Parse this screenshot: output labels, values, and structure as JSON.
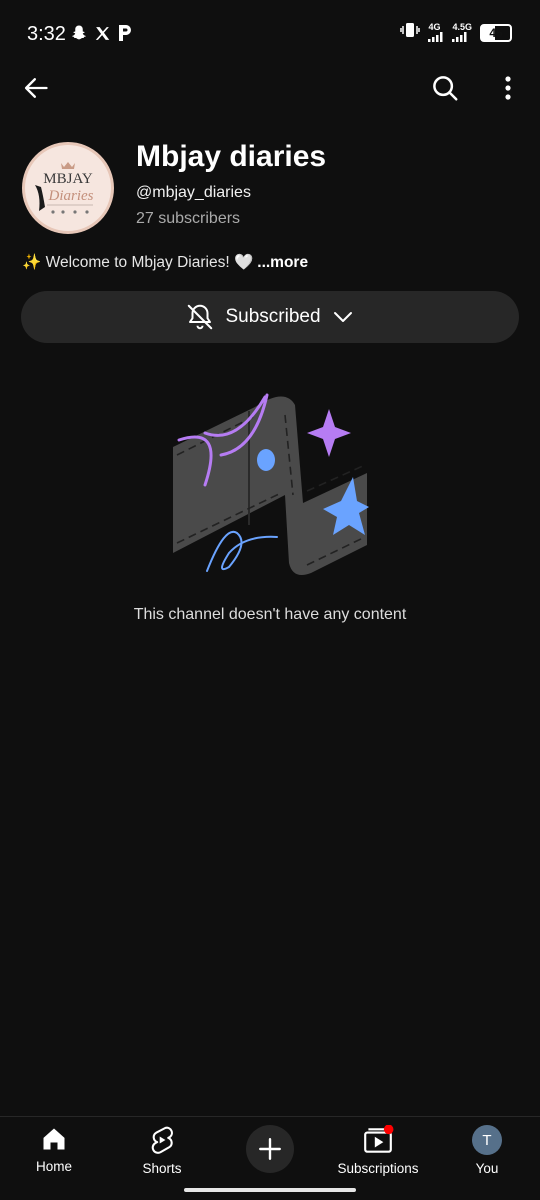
{
  "status_bar": {
    "time": "3:32",
    "network_1": "4G",
    "network_2": "4.5G",
    "battery": "45",
    "battery_level": 0.45
  },
  "top_bar": {
    "icons": [
      "back-arrow-icon",
      "search-icon",
      "more-vert-icon"
    ]
  },
  "channel": {
    "name": "Mbjay diaries",
    "handle": "@mbjay_diaries",
    "subscribers": "27 subscribers",
    "avatar_text_top": "MBJAY",
    "avatar_text_script": "Diaries",
    "description": "✨ Welcome to Mbjay Diaries! 🤍",
    "more_label": "...more"
  },
  "subscribe_button": {
    "label": "Subscribed",
    "icon": "bell-off-icon"
  },
  "empty_state": {
    "message": "This channel doesn't have any content"
  },
  "bottom_nav": {
    "items": [
      {
        "label": "Home",
        "icon": "home-icon"
      },
      {
        "label": "Shorts",
        "icon": "shorts-icon"
      },
      {
        "label": "",
        "icon": "plus-icon"
      },
      {
        "label": "Subscriptions",
        "icon": "subscriptions-icon"
      },
      {
        "label": "You",
        "icon": "avatar"
      }
    ],
    "you_initial": "T"
  },
  "colors": {
    "background": "#0f0f0f",
    "button_bg": "#272727",
    "accent_purple": "#b67cf3",
    "accent_blue": "#6aa3ff",
    "notification_red": "#ff0000"
  }
}
